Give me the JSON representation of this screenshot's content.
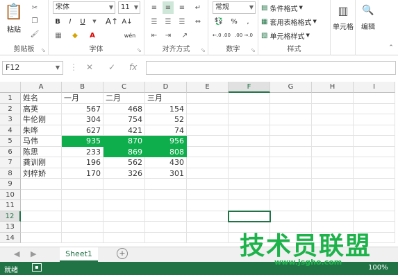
{
  "ribbon": {
    "clipboard": {
      "paste_label": "粘贴",
      "group_label": "剪贴板"
    },
    "font": {
      "font_name": "宋体",
      "font_size": "11",
      "group_label": "字体",
      "bold": "B",
      "italic": "I",
      "underline": "U",
      "font_color_letter": "A",
      "phonetic": "wén"
    },
    "alignment": {
      "group_label": "对齐方式"
    },
    "number": {
      "format": "常规",
      "group_label": "数字",
      "percent": "%",
      "comma": ",",
      "increase_dec": "←.0 .00",
      "decrease_dec": ".00 →.0"
    },
    "styles": {
      "conditional": "条件格式",
      "table_format": "套用表格格式",
      "cell_styles": "单元格样式",
      "group_label": "样式"
    },
    "cells": {
      "label": "单元格"
    },
    "editing": {
      "label": "编辑"
    }
  },
  "formula_bar": {
    "name_box": "F12",
    "fx": "fx",
    "cancel": "✕",
    "enter": "✓"
  },
  "columns": [
    "A",
    "B",
    "C",
    "D",
    "E",
    "F",
    "G",
    "H",
    "I"
  ],
  "rows": [
    "1",
    "2",
    "3",
    "4",
    "5",
    "6",
    "7",
    "8",
    "9",
    "10",
    "11",
    "12",
    "13",
    "14"
  ],
  "table": {
    "header": [
      "姓名",
      "一月",
      "二月",
      "三月"
    ],
    "data": [
      [
        "高英",
        "567",
        "468",
        "154"
      ],
      [
        "牛伦刚",
        "304",
        "754",
        "52"
      ],
      [
        "朱哗",
        "627",
        "421",
        "74"
      ],
      [
        "马伟",
        "935",
        "870",
        "956"
      ],
      [
        "陈思",
        "233",
        "869",
        "808"
      ],
      [
        "龚训刚",
        "196",
        "562",
        "430"
      ],
      [
        "刘梓娇",
        "170",
        "326",
        "301"
      ]
    ]
  },
  "highlight_color": "#0fae4d",
  "accent_color": "#217346",
  "sheet_tab": "Sheet1",
  "status": {
    "ready": "就绪",
    "zoom": "100%"
  },
  "watermark": {
    "text": "技术员联盟",
    "url": "www.jsgho.com"
  }
}
